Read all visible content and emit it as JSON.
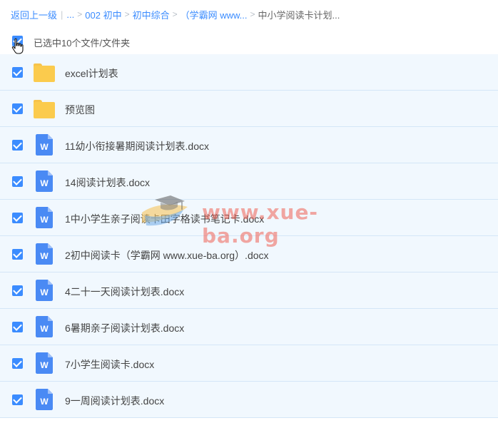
{
  "breadcrumb": {
    "back_label": "返回上一级",
    "ellipsis": "...",
    "items": [
      "002 初中",
      "初中综合",
      "（学霸网 www...",
      "中小学阅读卡计划..."
    ]
  },
  "selection": {
    "text": "已选中10个文件/文件夹",
    "all_checked": true
  },
  "files": [
    {
      "name": "excel计划表",
      "type": "folder",
      "checked": true
    },
    {
      "name": "预览图",
      "type": "folder",
      "checked": true
    },
    {
      "name": "11幼小衔接暑期阅读计划表.docx",
      "type": "docx",
      "checked": true
    },
    {
      "name": "14阅读计划表.docx",
      "type": "docx",
      "checked": true
    },
    {
      "name": "1中小学生亲子阅读卡田字格读书笔记卡.docx",
      "type": "docx",
      "checked": true
    },
    {
      "name": "2初中阅读卡（学霸网 www.xue-ba.org）.docx",
      "type": "docx",
      "checked": true
    },
    {
      "name": "4二十一天阅读计划表.docx",
      "type": "docx",
      "checked": true
    },
    {
      "name": "6暑期亲子阅读计划表.docx",
      "type": "docx",
      "checked": true
    },
    {
      "name": "7小学生阅读卡.docx",
      "type": "docx",
      "checked": true
    },
    {
      "name": "9一周阅读计划表.docx",
      "type": "docx",
      "checked": true
    }
  ],
  "watermark": {
    "text": "www.xue-ba.org"
  },
  "colors": {
    "accent": "#3b8cff",
    "row_bg": "#f1f8fe",
    "row_border": "#d4e6f7",
    "folder": "#fbcb4d",
    "doc": "#4a8af4"
  }
}
